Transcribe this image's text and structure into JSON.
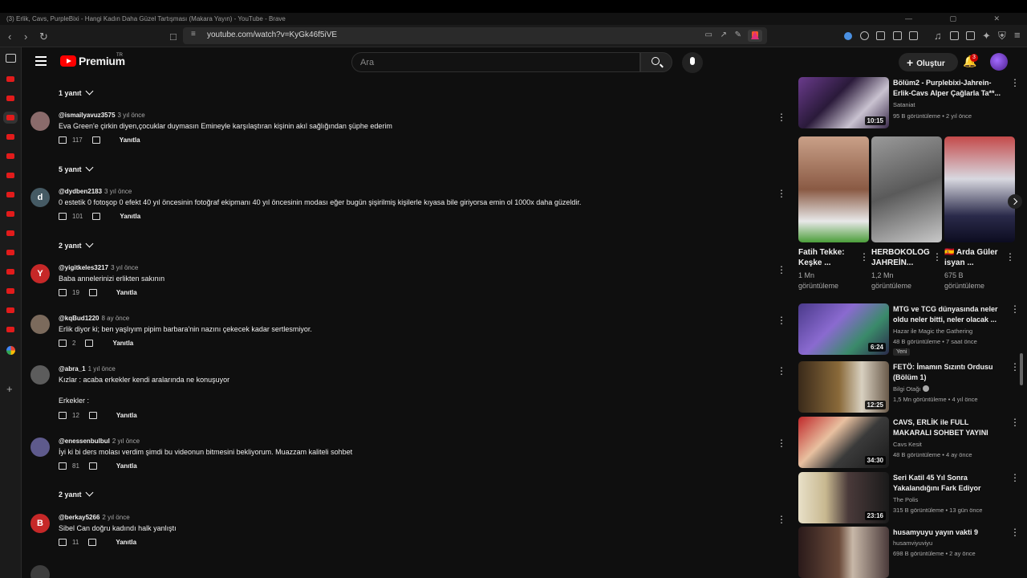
{
  "browser": {
    "window_title": "(3) Erlik, Cavs, PurpleBixi - Hangi Kadın Daha Güzel Tartışması (Makara Yayın) - YouTube - Brave",
    "url": "youtube.com/watch?v=KyGk46f5iVE"
  },
  "header": {
    "logo_text": "Premium",
    "logo_region": "TR",
    "search_placeholder": "Ara",
    "create_label": "Oluştur",
    "notification_count": "3"
  },
  "comments": {
    "reply_toggles": [
      "1 yanıt",
      "5 yanıt",
      "2 yanıt",
      "2 yanıt"
    ],
    "reply_label": "Yanıtla",
    "items": [
      {
        "user": "@ismailyavuz3575",
        "time": "3 yıl önce",
        "text": "Eva Green'e çirkin diyen,çocuklar duymasın Emineyle karşılaştıran kişinin akıl sağlığından şüphe ederim",
        "likes": "117",
        "avatar_letter": "",
        "avatar_color": "#8a6b6b"
      },
      {
        "user": "@dydben2183",
        "time": "3 yıl önce",
        "text": "0 estetik 0 fotoşop 0 efekt 40 yıl öncesinin fotoğraf ekipmanı 40 yıl öncesinin modası eğer bugün şişirilmiş kişilerle kıyasa bile giriyorsa emin ol 1000x daha güzeldir.",
        "likes": "101",
        "avatar_letter": "d",
        "avatar_color": "#455a64"
      },
      {
        "user": "@yigitkeles3217",
        "time": "3 yıl önce",
        "text": "Baba annelerinizi erlikten sakının",
        "likes": "19",
        "avatar_letter": "Y",
        "avatar_color": "#c62828"
      },
      {
        "user": "@kqBud1220",
        "time": "8 ay önce",
        "text": "Erlik diyor ki; ben yaşlıyım pipim barbara'nin nazını çekecek kadar sertlesmiyor.",
        "likes": "2",
        "avatar_letter": "",
        "avatar_color": "#7b6a5c"
      },
      {
        "user": "@abra_1",
        "time": "1 yıl önce",
        "text": "Kızlar : acaba erkekler kendi aralarında ne konuşuyor",
        "text2": "Erkekler :",
        "likes": "12",
        "avatar_letter": "",
        "avatar_color": "#5c5c5c"
      },
      {
        "user": "@enessenbulbul",
        "time": "2 yıl önce",
        "text": "İyi ki bi ders molası verdim şimdi bu videonun bitmesini bekliyorum. Muazzam kaliteli sohbet",
        "likes": "81",
        "avatar_letter": "",
        "avatar_color": "#5e5a8c"
      },
      {
        "user": "@berkay5266",
        "time": "2 yıl önce",
        "text": "Sibel Can doğru kadındı halk yanlıştı",
        "likes": "11",
        "avatar_letter": "B",
        "avatar_color": "#c62828"
      }
    ]
  },
  "sidebar": {
    "top_video": {
      "title": "Bölüm2 - Purplebixi-Jahrein-Erlik-Cavs Alper Çağlarla Ta**...",
      "channel": "Sataniat",
      "meta": "95 B görüntüleme • 2 yıl önce",
      "duration": "10:15"
    },
    "shorts": [
      {
        "title": "Fatih Tekke: Keşke ...",
        "views": "1 Mn",
        "views_label": "görüntüleme"
      },
      {
        "title": "HERBOKOLOG JAHREİN...",
        "views": "1,2 Mn",
        "views_label": "görüntüleme"
      },
      {
        "title": "🇪🇸 Arda Güler isyan ...",
        "views": "675 B",
        "views_label": "görüntüleme"
      }
    ],
    "videos": [
      {
        "title": "MTG ve TCG dünyasında neler oldu neler bitti, neler olacak ...",
        "channel": "Hazar ile Magic the Gathering",
        "meta": "48 B görüntüleme • 7 saat önce",
        "duration": "6:24",
        "badge": "Yeni"
      },
      {
        "title": "FETÖ: İmamın Sızıntı Ordusu (Bölüm 1)",
        "channel": "Bilgi Otağı",
        "meta": "1,5 Mn görüntüleme • 4 yıl önce",
        "duration": "12:25",
        "badge": ""
      },
      {
        "title": "CAVS, ERLİK ile FULL MAKARALI SOHBET YAYINI",
        "channel": "Cavs Kesit",
        "meta": "48 B görüntüleme • 4 ay önce",
        "duration": "34:30",
        "badge": ""
      },
      {
        "title": "Seri Katil 45 Yıl Sonra Yakalandığını Fark Ediyor",
        "channel": "The Polis",
        "meta": "315 B görüntüleme • 13 gün önce",
        "duration": "23:16",
        "badge": ""
      },
      {
        "title": "husamyuyu yayın vakti 9",
        "channel": "husamviyuviyu",
        "meta": "698 B görüntüleme • 2 ay önce",
        "duration": "",
        "badge": ""
      }
    ]
  }
}
